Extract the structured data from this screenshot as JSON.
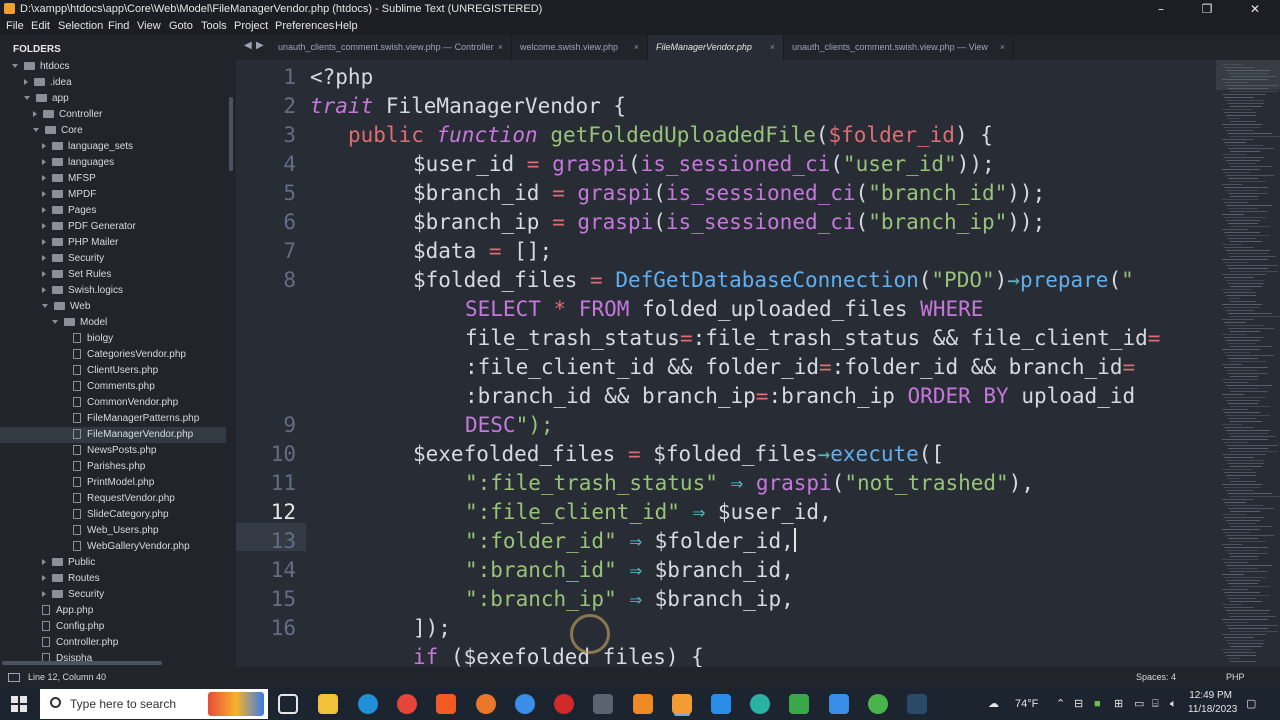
{
  "window": {
    "title": "D:\\xampp\\htdocs\\app\\Core\\Web\\Model\\FileManagerVendor.php (htdocs) - Sublime Text (UNREGISTERED)",
    "minimize": "–",
    "maximize": "❐",
    "close": "✕"
  },
  "menu": [
    "File",
    "Edit",
    "Selection",
    "Find",
    "View",
    "Goto",
    "Tools",
    "Project",
    "Preferences",
    "Help"
  ],
  "sidebar": {
    "heading": "FOLDERS",
    "items": [
      {
        "label": "htdocs",
        "kind": "folder",
        "open": true
      },
      {
        "label": ".idea",
        "kind": "folder",
        "open": false
      },
      {
        "label": "app",
        "kind": "folder",
        "open": true
      },
      {
        "label": "Controller",
        "kind": "folder",
        "open": false
      },
      {
        "label": "Core",
        "kind": "folder",
        "open": true
      },
      {
        "label": "language_sets",
        "kind": "folder",
        "open": false
      },
      {
        "label": "languages",
        "kind": "folder",
        "open": false
      },
      {
        "label": "MFSP",
        "kind": "folder",
        "open": false
      },
      {
        "label": "MPDF",
        "kind": "folder",
        "open": false
      },
      {
        "label": "Pages",
        "kind": "folder",
        "open": false
      },
      {
        "label": "PDF Generator",
        "kind": "folder",
        "open": false
      },
      {
        "label": "PHP Mailer",
        "kind": "folder",
        "open": false
      },
      {
        "label": "Security",
        "kind": "folder",
        "open": false
      },
      {
        "label": "Set Rules",
        "kind": "folder",
        "open": false
      },
      {
        "label": "Swish.logics",
        "kind": "folder",
        "open": false
      },
      {
        "label": "Web",
        "kind": "folder",
        "open": true
      },
      {
        "label": "Model",
        "kind": "folder",
        "open": true
      },
      {
        "label": "biolgy",
        "kind": "file"
      },
      {
        "label": "CategoriesVendor.php",
        "kind": "file"
      },
      {
        "label": "ClientUsers.php",
        "kind": "file"
      },
      {
        "label": "Comments.php",
        "kind": "file"
      },
      {
        "label": "CommonVendor.php",
        "kind": "file"
      },
      {
        "label": "FileManagerPatterns.php",
        "kind": "file"
      },
      {
        "label": "FileManagerVendor.php",
        "kind": "file",
        "selected": true
      },
      {
        "label": "NewsPosts.php",
        "kind": "file"
      },
      {
        "label": "Parishes.php",
        "kind": "file"
      },
      {
        "label": "PrintModel.php",
        "kind": "file"
      },
      {
        "label": "RequestVendor.php",
        "kind": "file"
      },
      {
        "label": "SlideCategory.php",
        "kind": "file"
      },
      {
        "label": "Web_Users.php",
        "kind": "file"
      },
      {
        "label": "WebGalleryVendor.php",
        "kind": "file"
      },
      {
        "label": "Public",
        "kind": "folder",
        "open": false
      },
      {
        "label": "Routes",
        "kind": "folder",
        "open": false
      },
      {
        "label": "Security",
        "kind": "folder",
        "open": false
      },
      {
        "label": "App.php",
        "kind": "file"
      },
      {
        "label": "Config.php",
        "kind": "file"
      },
      {
        "label": "Controller.php",
        "kind": "file"
      },
      {
        "label": "Dsispha",
        "kind": "file"
      }
    ]
  },
  "tabs": {
    "nav_left": "◀",
    "nav_right": "▶",
    "items": [
      {
        "label": "unauth_clients_comment.swish.view.php — Controller",
        "active": false
      },
      {
        "label": "welcome.swish.view.php",
        "active": false
      },
      {
        "label": "FileManagerVendor.php",
        "active": true
      },
      {
        "label": "unauth_clients_comment.swish.view.php — View",
        "active": false
      }
    ],
    "close_glyph": "×"
  },
  "editor": {
    "gutter": [
      "1",
      "2",
      "3",
      "4",
      "5",
      "6",
      "7",
      "8",
      "",
      "",
      "",
      "",
      "9",
      "10",
      "11",
      "12",
      "13",
      "14",
      "15",
      "16"
    ],
    "current_line": "12",
    "code": {
      "l1": "<?php",
      "l2a": "trait",
      "l2b": " FileManagerVendor {",
      "l3a": "public",
      "l3b": "function",
      "l3c": "getFoldedUploadedFile",
      "l3d": "(",
      "l3e": "$folder_id",
      "l3f": ") {",
      "l4a": "$user_id",
      "l4b": " = ",
      "l4c": "graspi",
      "l4d": "(",
      "l4e": "is_sessioned_ci",
      "l4f": "(",
      "l4g": "\"user_id\"",
      "l4h": "));",
      "l5a": "$branch_id",
      "l5b": " = ",
      "l5c": "graspi",
      "l5d": "(",
      "l5e": "is_sessioned_ci",
      "l5f": "(",
      "l5g": "\"branch_id\"",
      "l5h": "));",
      "l6a": "$branch_ip",
      "l6b": " = ",
      "l6c": "graspi",
      "l6d": "(",
      "l6e": "is_sessioned_ci",
      "l6f": "(",
      "l6g": "\"branch_ip\"",
      "l6h": "));",
      "l7a": "$data",
      "l7b": " = ",
      "l7c": "[];",
      "l8a": "$folded_files",
      "l8b": " = ",
      "l8c": "DefGetDatabaseConnection",
      "l8d": "(",
      "l8e": "\"PDO\"",
      "l8f": ")",
      "l8g": "→",
      "l8h": "prepare",
      "l8i": "(",
      "l8j": "\"",
      "l8k1": "SELECT",
      "l8k2": " * ",
      "l8k3": "FROM",
      "l8k4": " folded_uploaded_files ",
      "l8k5": "WHERE",
      "l8l1": "file_trash_status",
      "l8l2": "=",
      "l8l3": ":file_trash_status && file_client_id",
      "l8l4": "=",
      "l8m1": ":file_client_id && folder_id",
      "l8m2": "=",
      "l8m3": ":folder_id && branch_id",
      "l8m4": "=",
      "l8n1": ":branch_id && branch_ip",
      "l8n2": "=",
      "l8n3": ":branch_ip ",
      "l8n4": "ORDER BY",
      "l8n5": " upload_id",
      "l8o1": "DESC",
      "l8o2": "\");",
      "l9a": "$exefolded_files",
      "l9b": " = ",
      "l9c": "$folded_files",
      "l9d": "→",
      "l9e": "execute",
      "l9f": "([",
      "l10a": "\":file_trash_status\"",
      "l10b": " ⇒ ",
      "l10c": "graspi",
      "l10d": "(",
      "l10e": "\"not_trashed\"",
      "l10f": "),",
      "l11a": "\":file_client_id\"",
      "l11b": " ⇒ ",
      "l11c": "$user_id",
      "l11d": ",",
      "l12a": "\":folder_id\"",
      "l12b": " ⇒ ",
      "l12c": "$folder_id",
      "l12d": ",",
      "l13a": "\":branch_id\"",
      "l13b": " ⇒ ",
      "l13c": "$branch_id",
      "l13d": ",",
      "l14a": "\":branch_ip\"",
      "l14b": " ⇒ ",
      "l14c": "$branch_ip",
      "l14d": ",",
      "l15": "]);",
      "l16a": "if",
      "l16b": " (",
      "l16c": "$exefolded_files",
      "l16d": ") {"
    }
  },
  "status": {
    "position": "Line 12, Column 40",
    "spaces": "Spaces: 4",
    "syntax": "PHP"
  },
  "taskbar": {
    "search_placeholder": "Type here to search",
    "weather": "74°F",
    "time": "12:49 PM",
    "date": "11/18/2023"
  }
}
